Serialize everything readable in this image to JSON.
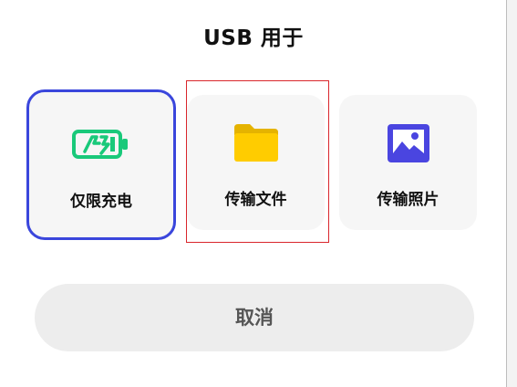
{
  "dialog": {
    "title": "USB 用于"
  },
  "options": [
    {
      "label": "仅限充电",
      "icon": "battery-charging-icon",
      "selected": true,
      "color": "#19c97a"
    },
    {
      "label": "传输文件",
      "icon": "folder-icon",
      "selected": false,
      "color": "#ffcc00"
    },
    {
      "label": "传输照片",
      "icon": "image-icon",
      "selected": false,
      "color": "#4a45e0"
    }
  ],
  "cancel_label": "取消",
  "colors": {
    "selected_border": "#3a46dc",
    "highlight_box": "#d9262c",
    "card_background": "#f6f6f6",
    "cancel_background": "#ededed"
  }
}
